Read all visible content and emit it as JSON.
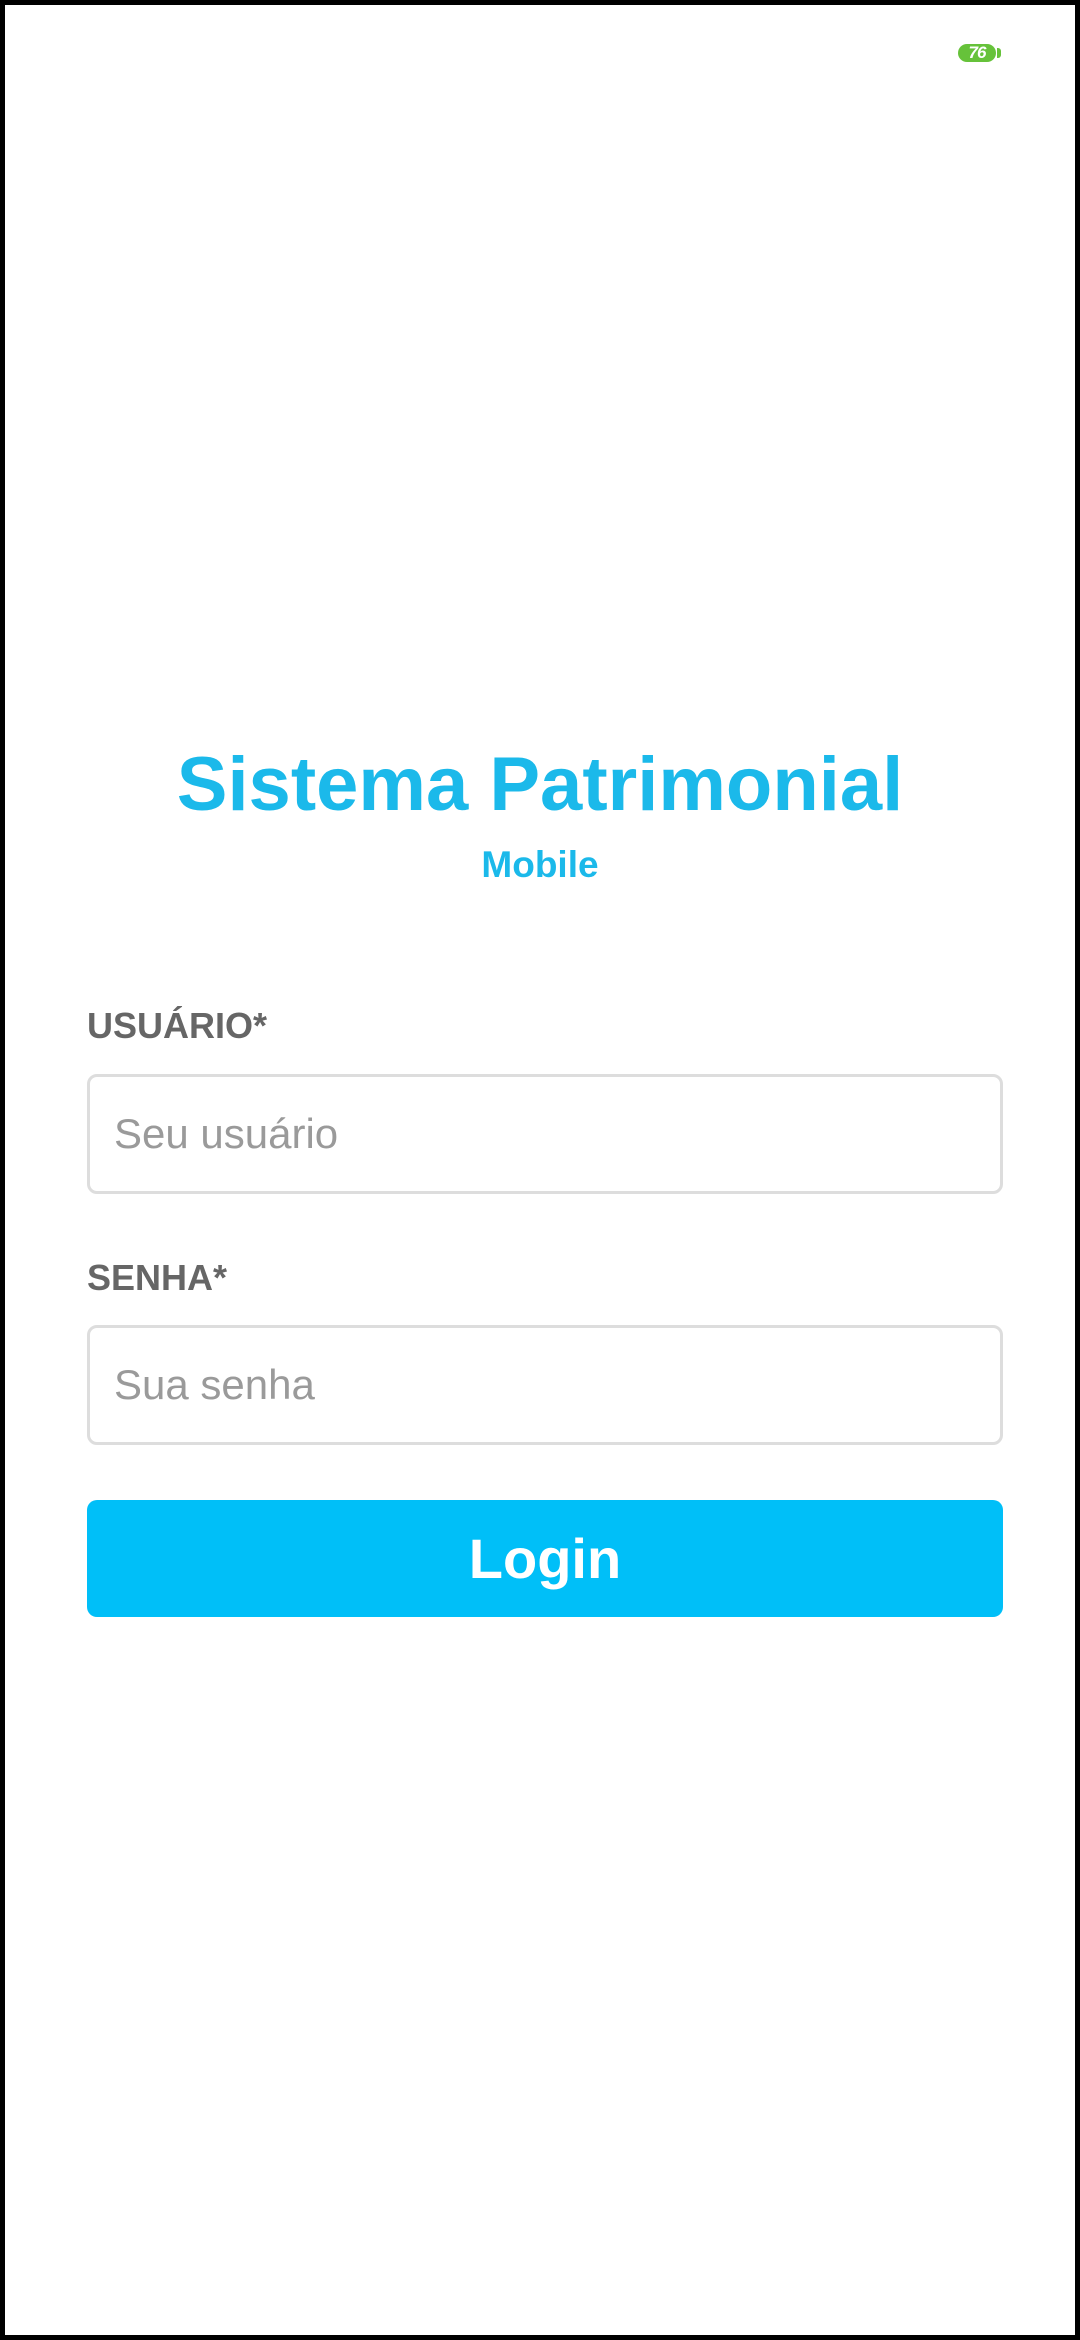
{
  "status_bar": {
    "battery_level": "76",
    "battery_color": "#66c23a"
  },
  "header": {
    "title": "Sistema Patrimonial",
    "subtitle": "Mobile"
  },
  "form": {
    "username": {
      "label": "USUÁRIO*",
      "value": "",
      "placeholder": "Seu usuário"
    },
    "password": {
      "label": "SENHA*",
      "value": "",
      "placeholder": "Sua senha"
    },
    "login_label": "Login"
  },
  "colors": {
    "accent": "#1bb9ea",
    "button": "#00bff8",
    "label": "#666666",
    "input_border": "#dddddd"
  }
}
